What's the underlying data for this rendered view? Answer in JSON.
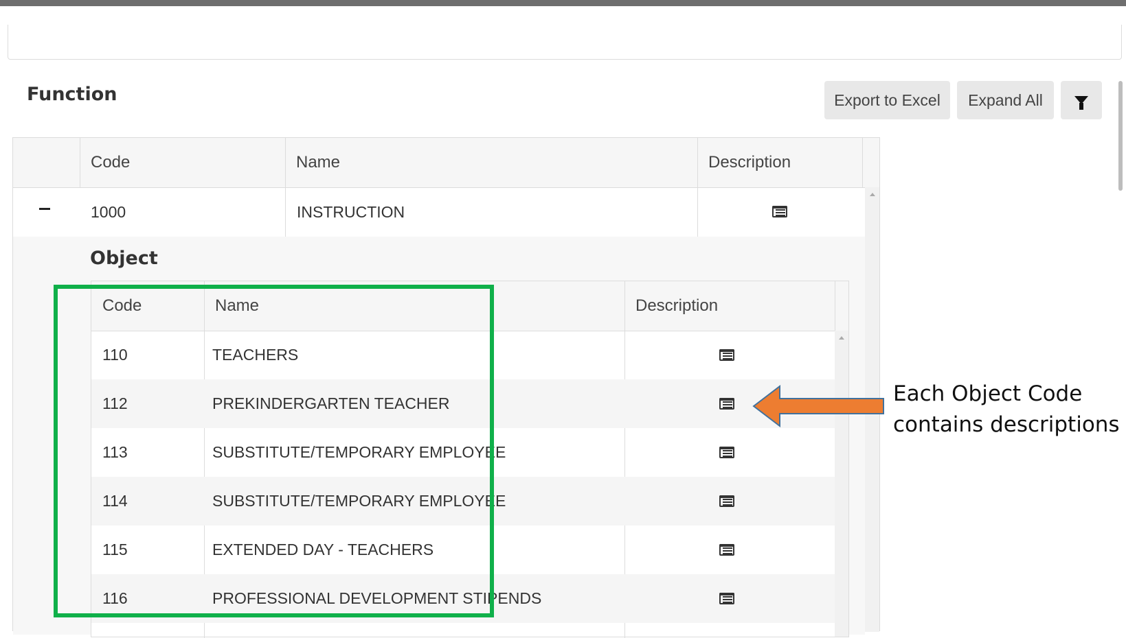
{
  "section_title": "Function",
  "toolbar": {
    "export_label": "Export to Excel",
    "expand_label": "Expand All",
    "filter_icon": "filter-icon"
  },
  "function_table": {
    "columns": [
      "Code",
      "Name",
      "Description"
    ],
    "rows": [
      {
        "code": "1000",
        "name": "INSTRUCTION",
        "expanded": true
      }
    ]
  },
  "object_section": {
    "title": "Object",
    "columns": [
      "Code",
      "Name",
      "Description"
    ],
    "rows": [
      {
        "code": "110",
        "name": "TEACHERS"
      },
      {
        "code": "112",
        "name": "PREKINDERGARTEN TEACHER"
      },
      {
        "code": "113",
        "name": "SUBSTITUTE/TEMPORARY EMPLOYEE"
      },
      {
        "code": "114",
        "name": "SUBSTITUTE/TEMPORARY EMPLOYEE"
      },
      {
        "code": "115",
        "name": "EXTENDED DAY - TEACHERS"
      },
      {
        "code": "116",
        "name": "PROFESSIONAL DEVELOPMENT STIPENDS"
      }
    ]
  },
  "annotation": {
    "line1": "Each Object Code",
    "line2": "contains descriptions",
    "arrow_color": "#ed7d31",
    "highlight_color": "#10b04a"
  }
}
